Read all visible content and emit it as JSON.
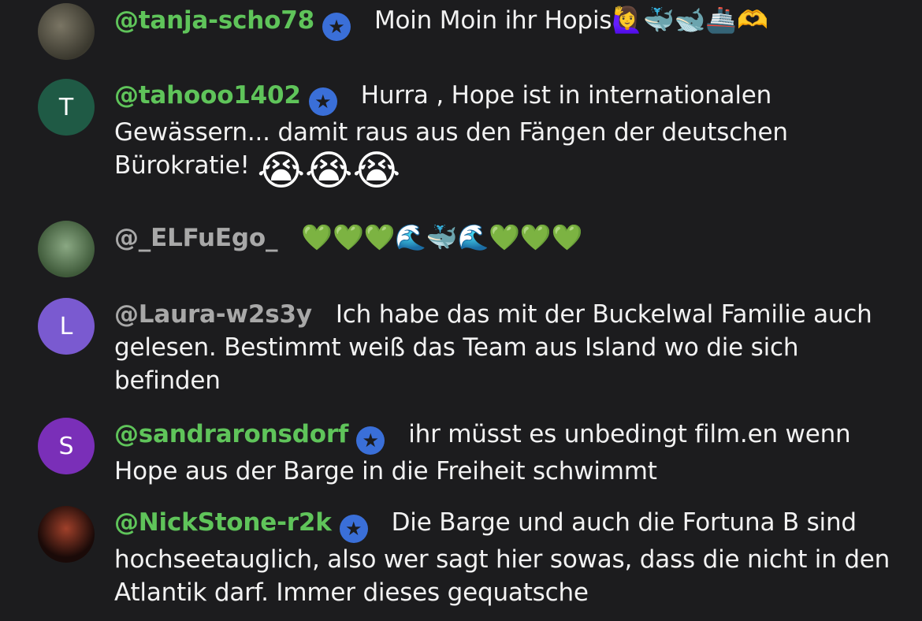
{
  "comments": [
    {
      "avatar_letter": "",
      "avatar_color": "#5a5a4a",
      "username": "@tanja-scho78",
      "verified": true,
      "text": "Moin Moin ihr Hopis",
      "emoji": "🙋‍♀️🐳🐋🚢🫶"
    },
    {
      "avatar_letter": "T",
      "avatar_color": "#1f5a45",
      "username": "@tahooo1402",
      "verified": true,
      "text": "Hurra , Hope ist in internationalen Gewässern... damit raus aus den Fängen der deutschen Bürokratie!",
      "emoji": "😭😭😭"
    },
    {
      "avatar_letter": "",
      "avatar_color": "#4b6a45",
      "username": "@_ELFuEgo_",
      "verified": false,
      "text": "",
      "emoji": "💚💚💚🌊🐳🌊💚💚💚"
    },
    {
      "avatar_letter": "L",
      "avatar_color": "#7a5ad0",
      "username": "@Laura-w2s3y",
      "verified": false,
      "text": "Ich habe das mit der Buckelwal Familie auch gelesen. Bestimmt weiß das Team aus Island wo die sich befinden",
      "emoji": ""
    },
    {
      "avatar_letter": "S",
      "avatar_color": "#7a2fb8",
      "username": "@sandraronsdorf",
      "verified": true,
      "text": "ihr müsst es unbedingt film.en wenn Hope aus der Barge in die Freiheit schwimmt",
      "emoji": ""
    },
    {
      "avatar_letter": "",
      "avatar_color": "#2a1410",
      "username": "@NickStone-r2k",
      "verified": true,
      "text": "Die Barge und auch die Fortuna B sind hochseetauglich, also wer sagt hier sowas, dass die nicht in den Atlantik darf. Immer dieses gequatsche",
      "emoji": ""
    }
  ],
  "icons": {
    "verified": "★"
  }
}
